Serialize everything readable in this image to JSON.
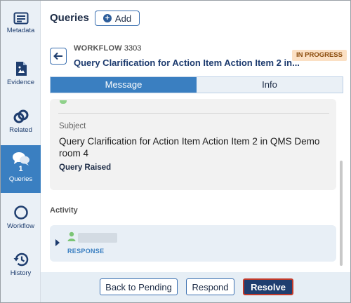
{
  "sidebar": {
    "items": [
      {
        "label": "Metadata",
        "icon": "metadata-icon"
      },
      {
        "label": "Evidence",
        "icon": "evidence-icon"
      },
      {
        "label": "Related",
        "icon": "link-icon"
      },
      {
        "label": "Queries",
        "icon": "chat-bubbles-icon",
        "count": "1",
        "active": true
      },
      {
        "label": "Workflow",
        "icon": "circle-icon"
      },
      {
        "label": "History",
        "icon": "history-icon"
      }
    ]
  },
  "header": {
    "title": "Queries",
    "add_label": "Add"
  },
  "workflow": {
    "label": "WORKFLOW",
    "number": "3303",
    "title": "Query Clarification for Action Item Action Item 2 in...",
    "status": "IN PROGRESS"
  },
  "tabs": [
    {
      "label": "Message",
      "active": true
    },
    {
      "label": "Info",
      "active": false
    }
  ],
  "message": {
    "subject_label": "Subject",
    "subject_text": "Query Clarification for Action Item Action Item 2 in QMS Demo room 4",
    "status_text": "Query Raised"
  },
  "activity": {
    "heading": "Activity",
    "entry_type": "RESPONSE"
  },
  "footer": {
    "back_label": "Back to Pending",
    "respond_label": "Respond",
    "resolve_label": "Resolve"
  },
  "colors": {
    "accent": "#3a7fc1",
    "navy": "#1f3e6f",
    "badge_bg": "#fbe0c4",
    "badge_text": "#8a4b0c"
  }
}
